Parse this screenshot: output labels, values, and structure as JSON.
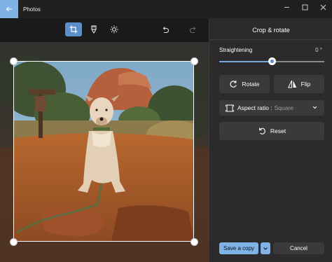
{
  "window": {
    "title": "Photos",
    "back_icon": "back-arrow-icon",
    "controls": [
      "minimize-icon",
      "maximize-icon",
      "close-icon"
    ]
  },
  "toolbar": {
    "tools": [
      {
        "name": "crop",
        "icon": "crop-icon",
        "active": true
      },
      {
        "name": "filter",
        "icon": "filter-icon",
        "active": false
      },
      {
        "name": "adjust",
        "icon": "brightness-icon",
        "active": false
      }
    ],
    "undo_icon": "undo-icon",
    "redo_icon": "redo-icon"
  },
  "panel": {
    "title": "Crop & rotate",
    "straightening": {
      "label": "Straightening",
      "value": "0 °",
      "fraction": 0.5
    },
    "rotate_label": "Rotate",
    "flip_label": "Flip",
    "aspect_ratio": {
      "label": "Aspect ratio :",
      "value": "Square"
    },
    "reset_label": "Reset",
    "save_label": "Save a copy",
    "cancel_label": "Cancel"
  },
  "colors": {
    "accent": "#7fb3e6",
    "panel_bg": "#2b2b2b",
    "button_bg": "#3a3a3a"
  }
}
